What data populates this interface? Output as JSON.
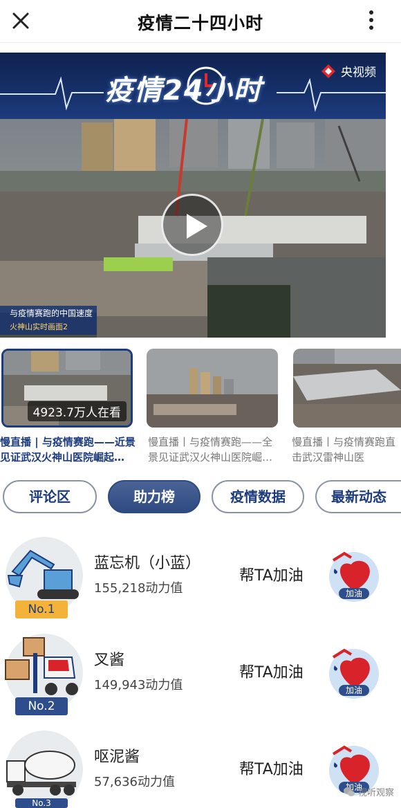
{
  "header": {
    "title": "疫情二十四小时"
  },
  "banner": {
    "title": "疫情24小时",
    "channel": "央视频"
  },
  "video": {
    "caption_line1": "与疫情赛跑的中国速度",
    "caption_line2": "火神山实时画面2"
  },
  "live_list": [
    {
      "title": "慢直播 | 与疫情赛跑——近景见证武汉火神山医院崛起…",
      "viewers": "4923.7万人在看"
    },
    {
      "title": "慢直播丨与疫情赛跑——全景见证武汉火神山医院崛…"
    },
    {
      "title": "慢直播丨与疫情赛跑直击武汉雷神山医"
    }
  ],
  "tabs": [
    {
      "label": "评论区"
    },
    {
      "label": "助力榜"
    },
    {
      "label": "疫情数据"
    },
    {
      "label": "最新动态"
    }
  ],
  "leaderboard": [
    {
      "name": "蓝忘机（小蓝）",
      "power": "155,218动力值",
      "rank": "No.1",
      "cheer": "帮TA加油",
      "boost": "加油"
    },
    {
      "name": "叉酱",
      "power": "149,943动力值",
      "rank": "No.2",
      "cheer": "帮TA加油",
      "boost": "加油"
    },
    {
      "name": "呕泥酱",
      "power": "57,636动力值",
      "rank": "No.3",
      "cheer": "帮TA加油",
      "boost": "加油"
    }
  ],
  "watermark": "视听观察",
  "colors": {
    "accent": "#1d3c7d",
    "gold": "#f3b23a",
    "banner_bg": "#16306a",
    "boost_red": "#d8232a"
  }
}
